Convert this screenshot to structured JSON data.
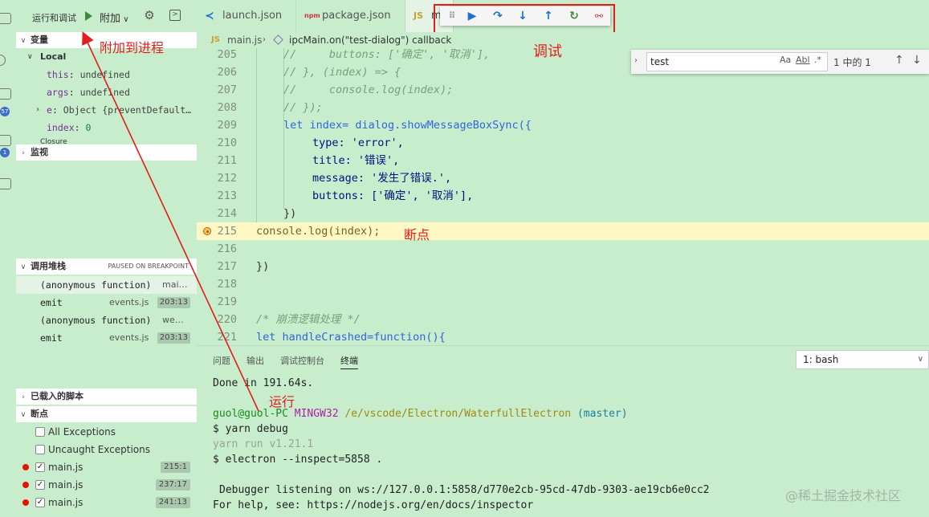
{
  "sidebar": {
    "title": "运行和调试",
    "config": "附加",
    "sections": {
      "variables": "变量",
      "watch": "监视",
      "callstack": "调用堆栈",
      "paused": "PAUSED ON BREAKPOINT",
      "loaded_scripts": "已载入的脚本",
      "breakpoints": "断点"
    },
    "scope_local": "Local",
    "scope_closure": "Closure",
    "variables": [
      {
        "name": "this",
        "value": "undefined"
      },
      {
        "name": "args",
        "value": "undefined"
      },
      {
        "name": "e",
        "value": "Object {preventDefault…"
      },
      {
        "name": "index",
        "value": "0"
      }
    ],
    "call_stack": [
      {
        "fn": "(anonymous function)",
        "file": "mai…",
        "line": ""
      },
      {
        "fn": "emit",
        "file": "events.js",
        "line": "203:13"
      },
      {
        "fn": "(anonymous function)",
        "file": "we…",
        "line": ""
      },
      {
        "fn": "emit",
        "file": "events.js",
        "line": "203:13"
      }
    ],
    "breakpoints": [
      {
        "label": "All Exceptions",
        "checked": false,
        "dot": false,
        "loc": ""
      },
      {
        "label": "Uncaught Exceptions",
        "checked": false,
        "dot": false,
        "loc": ""
      },
      {
        "label": "main.js",
        "checked": true,
        "dot": true,
        "loc": "215:1"
      },
      {
        "label": "main.js",
        "checked": true,
        "dot": true,
        "loc": "237:17"
      },
      {
        "label": "main.js",
        "checked": true,
        "dot": true,
        "loc": "241:13"
      }
    ],
    "badges": [
      "57",
      "1"
    ]
  },
  "tabs": [
    {
      "label": "launch.json",
      "icon": "vscode-icon"
    },
    {
      "label": "package.json",
      "icon": "npm-icon"
    },
    {
      "label": "m",
      "icon": "js-icon"
    }
  ],
  "breadcrumb": {
    "file": "main.js",
    "symbol": "ipcMain.on(\"test-dialog\") callback"
  },
  "find": {
    "value": "test",
    "count": "1 中的 1",
    "opt_case": "Aa",
    "opt_word": "Abl",
    "opt_regex": ".*"
  },
  "code_lines": [
    {
      "n": "205",
      "t": "//     buttons: ['确定', '取消'],"
    },
    {
      "n": "206",
      "t": "// }, (index) => {"
    },
    {
      "n": "207",
      "t": "//     console.log(index);"
    },
    {
      "n": "208",
      "t": "// });"
    },
    {
      "n": "209",
      "t": "let index= dialog.showMessageBoxSync({"
    },
    {
      "n": "210",
      "t": "type: 'error',"
    },
    {
      "n": "211",
      "t": "title: '错误',"
    },
    {
      "n": "212",
      "t": "message: '发生了错误.',"
    },
    {
      "n": "213",
      "t": "buttons: ['确定', '取消'],"
    },
    {
      "n": "214",
      "t": "})"
    },
    {
      "n": "215",
      "t": "console.log(index);"
    },
    {
      "n": "216",
      "t": ""
    },
    {
      "n": "217",
      "t": "})"
    },
    {
      "n": "218",
      "t": ""
    },
    {
      "n": "219",
      "t": ""
    },
    {
      "n": "220",
      "t": "/* 崩溃逻辑处理 */"
    },
    {
      "n": "221",
      "t": "let handleCrashed=function(){"
    }
  ],
  "panel": {
    "tabs": [
      "问题",
      "输出",
      "调试控制台",
      "终端"
    ],
    "terminal_select": "1: bash",
    "terminal": {
      "done": "Done in 191.64s.",
      "user": "guol@guol-PC",
      "env": "MINGW32",
      "path": "/e/vscode/Electron/WaterfullElectron",
      "branch": "(master)",
      "cmd1": "$ yarn debug",
      "yarn_run": "yarn run v1.21.1",
      "cmd2": "$ electron --inspect=5858 .",
      "debugger": "Debugger listening on ws://127.0.0.1:5858/d770e2cb-95cd-47db-9303-ae19cb6e0cc2",
      "help": "For help, see: https://nodejs.org/en/docs/inspector"
    }
  },
  "annotations": {
    "attach": "附加到进程",
    "debug": "调试",
    "breakpoint": "断点",
    "run": "运行"
  },
  "watermark": "@稀土掘金技术社区",
  "colors": {
    "annotation": "#e11d1d",
    "bg": "#c7edcc"
  }
}
